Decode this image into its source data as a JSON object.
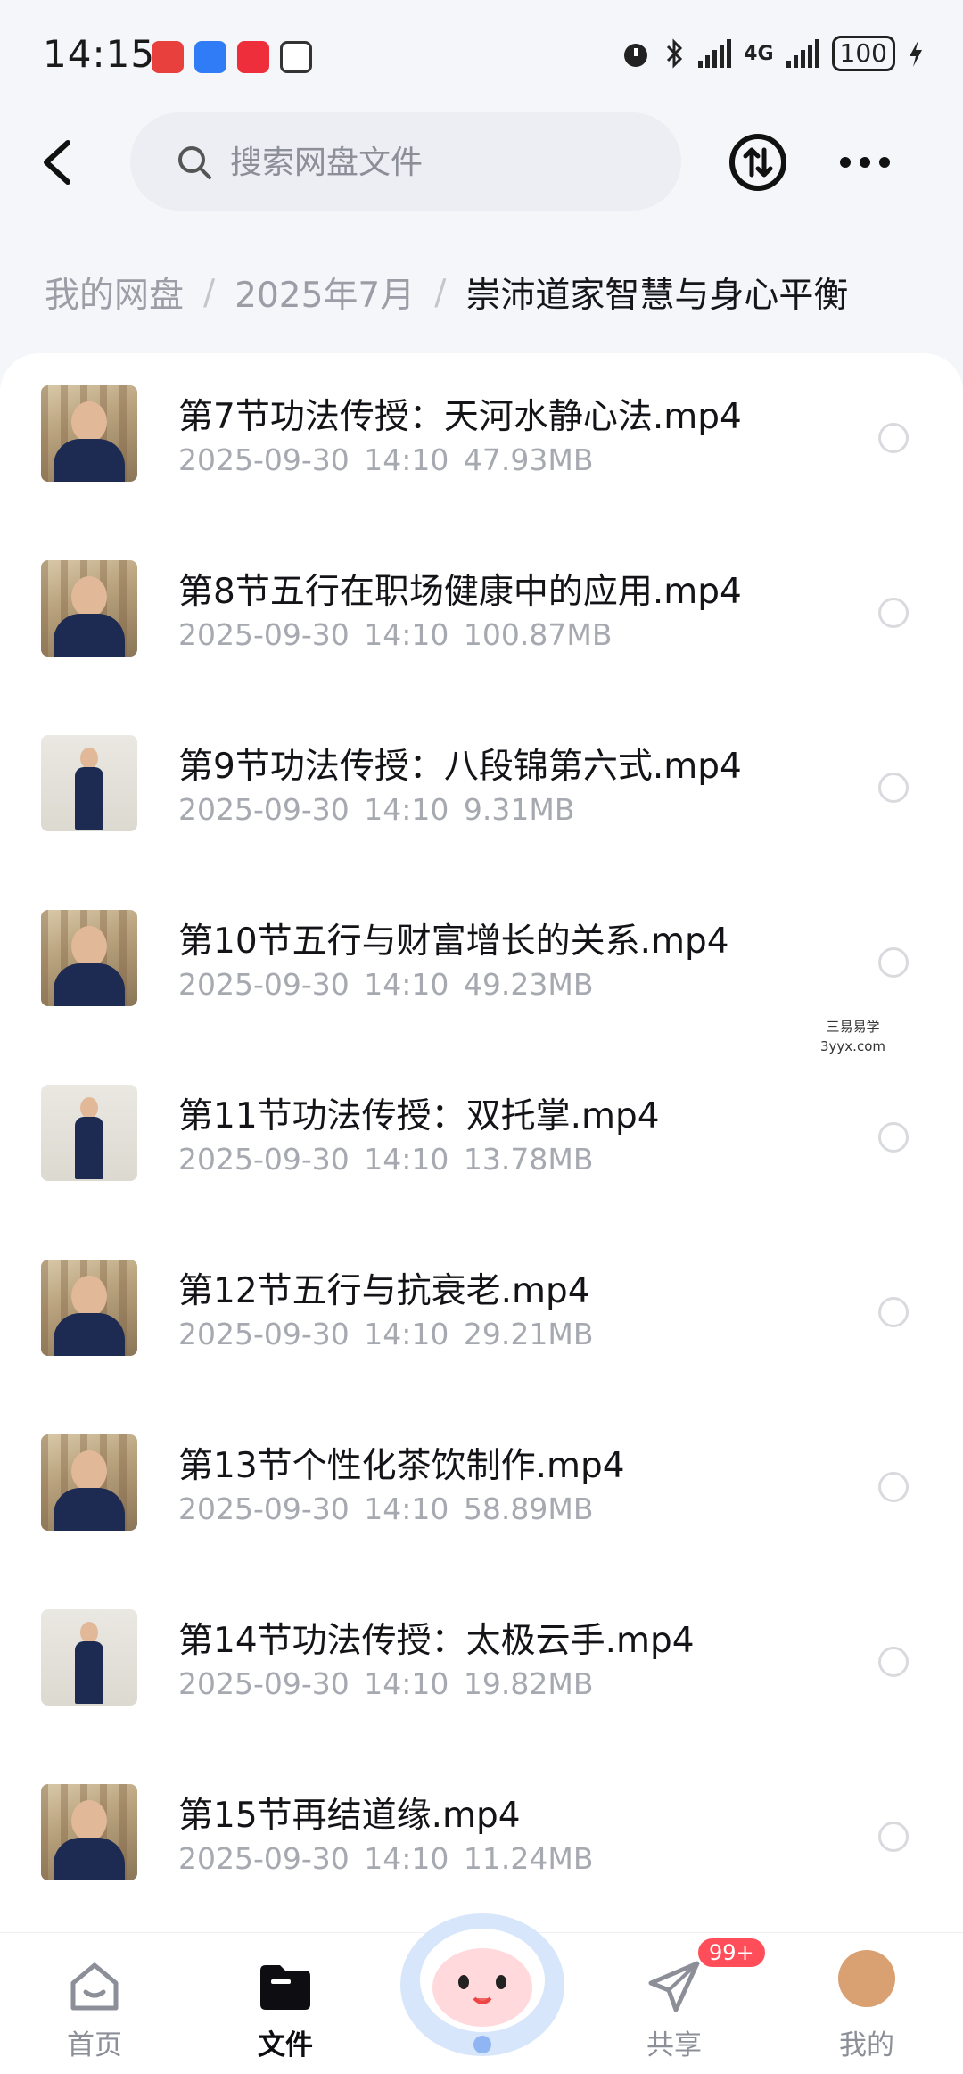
{
  "status_bar": {
    "time": "14:15",
    "network": "4G",
    "battery": "100"
  },
  "header": {
    "search_placeholder": "搜索网盘文件"
  },
  "breadcrumb": [
    "我的网盘",
    "2025年7月",
    "崇沛道家智慧与身心平衡"
  ],
  "files": [
    {
      "name": "第7节功法传授：天河水静心法.mp4",
      "date": "2025-09-30",
      "time": "14:10",
      "size": "47.93MB",
      "thumb": "seated"
    },
    {
      "name": "第8节五行在职场健康中的应用.mp4",
      "date": "2025-09-30",
      "time": "14:10",
      "size": "100.87MB",
      "thumb": "seated"
    },
    {
      "name": "第9节功法传授：八段锦第六式.mp4",
      "date": "2025-09-30",
      "time": "14:10",
      "size": "9.31MB",
      "thumb": "standing"
    },
    {
      "name": "第10节五行与财富增长的关系.mp4",
      "date": "2025-09-30",
      "time": "14:10",
      "size": "49.23MB",
      "thumb": "seated"
    },
    {
      "name": "第11节功法传授：双托掌.mp4",
      "date": "2025-09-30",
      "time": "14:10",
      "size": "13.78MB",
      "thumb": "standing"
    },
    {
      "name": "第12节五行与抗衰老.mp4",
      "date": "2025-09-30",
      "time": "14:10",
      "size": "29.21MB",
      "thumb": "seated"
    },
    {
      "name": "第13节个性化茶饮制作.mp4",
      "date": "2025-09-30",
      "time": "14:10",
      "size": "58.89MB",
      "thumb": "seated"
    },
    {
      "name": "第14节功法传授：太极云手.mp4",
      "date": "2025-09-30",
      "time": "14:10",
      "size": "19.82MB",
      "thumb": "standing"
    },
    {
      "name": "第15节再结道缘.mp4",
      "date": "2025-09-30",
      "time": "14:10",
      "size": "11.24MB",
      "thumb": "seated"
    }
  ],
  "watermark": {
    "line1": "三易易学",
    "line2": "3yyx.com"
  },
  "bottom_nav": {
    "home": "首页",
    "files": "文件",
    "share": "共享",
    "mine": "我的",
    "share_badge": "99+"
  },
  "colors": {
    "accent": "#0e0e12",
    "badge": "#ff4d5a",
    "meta_text": "#a6a9b0"
  }
}
